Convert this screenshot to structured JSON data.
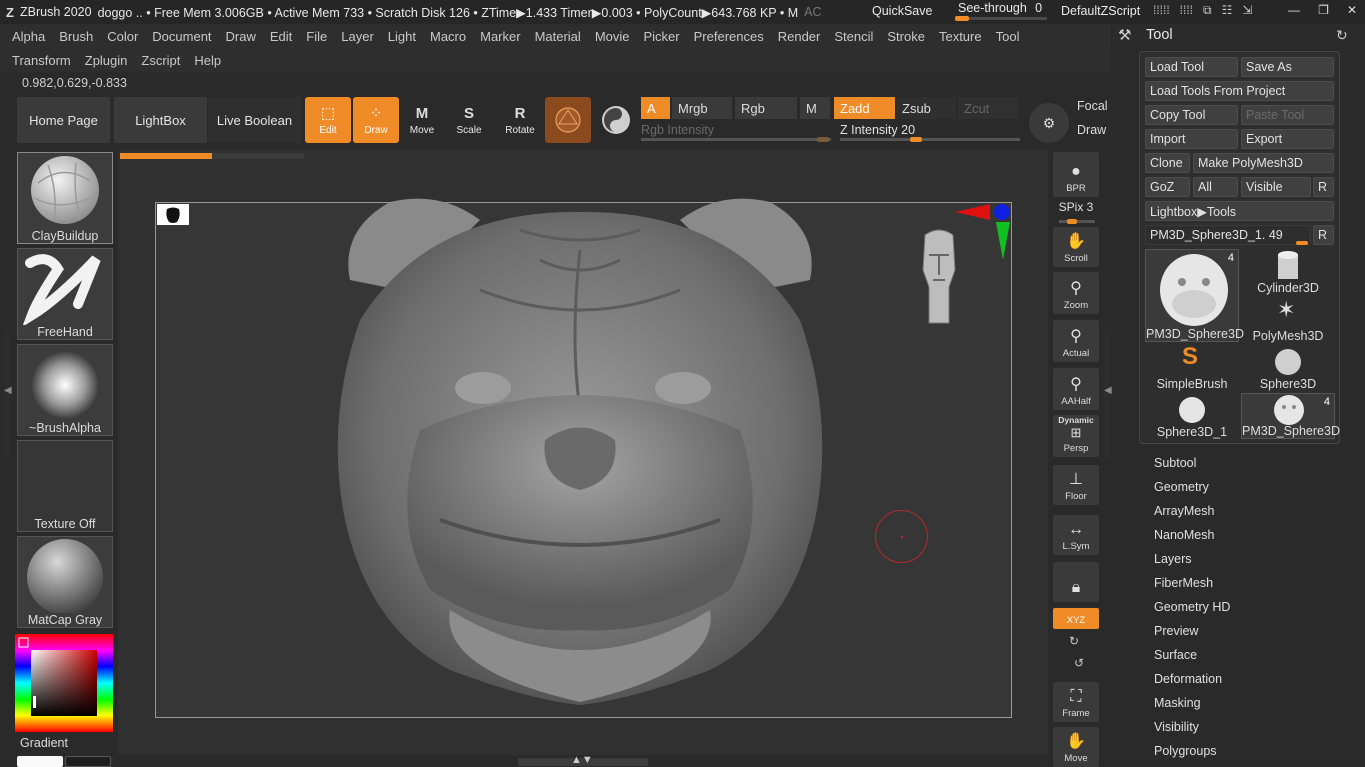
{
  "titlebar": {
    "app": "ZBrush 2020",
    "status": "doggo   .. • Free Mem 3.006GB • Active Mem 733 • Scratch Disk 126 •  ZTime▶1.433 Timer▶0.003 • PolyCount▶643.768 KP  • M",
    "ac": "AC",
    "quicksave": "QuickSave",
    "seethrough_label": "See-through",
    "seethrough_value": "0",
    "script": "DefaultZScript"
  },
  "menu_row1": [
    "Alpha",
    "Brush",
    "Color",
    "Document",
    "Draw",
    "Edit",
    "File",
    "Layer",
    "Light",
    "Macro",
    "Marker",
    "Material",
    "Movie",
    "Picker",
    "Preferences",
    "Render",
    "Stencil",
    "Stroke",
    "Texture",
    "Tool"
  ],
  "menu_row2": [
    "Transform",
    "Zplugin",
    "Zscript",
    "Help"
  ],
  "coords": "0.982,0.629,-0.833",
  "shelf": {
    "home": "Home Page",
    "lightbox": "LightBox",
    "liveboolean": "Live Boolean",
    "edit": "Edit",
    "draw": "Draw",
    "move": "Move",
    "scale": "Scale",
    "rotate": "Rotate",
    "a": "A",
    "mrgb": "Mrgb",
    "rgb": "Rgb",
    "m": "M",
    "zadd": "Zadd",
    "zsub": "Zsub",
    "zcut": "Zcut",
    "rgb_intensity": "Rgb Intensity",
    "z_intensity_label": "Z Intensity",
    "z_intensity_value": "20",
    "focal": "Focal",
    "draw2": "Draw"
  },
  "left_palette": [
    {
      "label": "ClayBuildup"
    },
    {
      "label": "FreeHand"
    },
    {
      "label": "~BrushAlpha"
    },
    {
      "label": "Texture Off"
    },
    {
      "label": "MatCap Gray"
    }
  ],
  "gradient_label": "Gradient",
  "canvas": {
    "progress": 0.5
  },
  "right_dock": {
    "bpr": "BPR",
    "spix_label": "SPix",
    "spix_value": "3",
    "scroll": "Scroll",
    "zoom": "Zoom",
    "actual": "Actual",
    "aahalf": "AAHalf",
    "dynamic": "Dynamic",
    "persp": "Persp",
    "floor": "Floor",
    "lsym": "L.Sym",
    "xyz": "XYZ",
    "frame": "Frame",
    "move": "Move"
  },
  "tool_palette": {
    "title": "Tool",
    "load_tool": "Load Tool",
    "save_as": "Save As",
    "load_from_project": "Load Tools From Project",
    "copy_tool": "Copy Tool",
    "paste_tool": "Paste Tool",
    "import": "Import",
    "export": "Export",
    "clone": "Clone",
    "make_polymesh": "Make PolyMesh3D",
    "goz": "GoZ",
    "all": "All",
    "visible": "Visible",
    "r": "R",
    "lightbox_tools": "Lightbox▶Tools",
    "current_tool": "PM3D_Sphere3D_1. 49",
    "thumbnails": [
      {
        "label": "PM3D_Sphere3D",
        "count": "4"
      },
      {
        "label": "Cylinder3D",
        "count": ""
      },
      {
        "label": "PolyMesh3D",
        "count": ""
      },
      {
        "label": "SimpleBrush",
        "count": ""
      },
      {
        "label": "Sphere3D",
        "count": ""
      },
      {
        "label": "Sphere3D_1",
        "count": ""
      },
      {
        "label": "PM3D_Sphere3D",
        "count": "4"
      }
    ],
    "subpalettes": [
      "Subtool",
      "Geometry",
      "ArrayMesh",
      "NanoMesh",
      "Layers",
      "FiberMesh",
      "Geometry HD",
      "Preview",
      "Surface",
      "Deformation",
      "Masking",
      "Visibility",
      "Polygroups"
    ]
  },
  "colors": {
    "accent": "#f08c28",
    "background": "#2a2a2a"
  }
}
